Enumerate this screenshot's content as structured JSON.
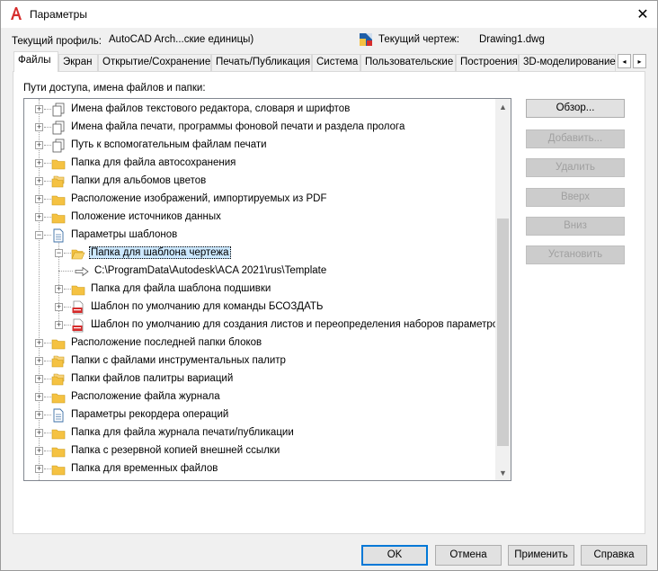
{
  "window": {
    "title": "Параметры",
    "close_symbol": "✕"
  },
  "profile": {
    "label": "Текущий профиль:",
    "value": "AutoCAD Arch...ские единицы)",
    "drawing_label": "Текущий чертеж:",
    "drawing_value": "Drawing1.dwg"
  },
  "tabs": [
    {
      "label": "Файлы",
      "active": true
    },
    {
      "label": "Экран"
    },
    {
      "label": "Открытие/Сохранение"
    },
    {
      "label": "Печать/Публикация"
    },
    {
      "label": "Система"
    },
    {
      "label": "Пользовательские"
    },
    {
      "label": "Построения"
    },
    {
      "label": "3D-моделирование"
    }
  ],
  "tab_scroll": {
    "left": "◂",
    "right": "▸"
  },
  "files": {
    "section_label": "Пути доступа, имена файлов и папки:",
    "tree": [
      {
        "label": "Имена файлов текстового редактора, словаря и шрифтов",
        "level": 0,
        "icon": "multi-doc-icon",
        "expander": "+"
      },
      {
        "label": "Имена файла печати, программы фоновой печати и раздела пролога",
        "level": 0,
        "icon": "multi-doc-icon",
        "expander": "+"
      },
      {
        "label": "Путь к вспомогательным файлам печати",
        "level": 0,
        "icon": "multi-doc-icon",
        "expander": "+"
      },
      {
        "label": "Папка для файла автосохранения",
        "level": 0,
        "icon": "folder-icon",
        "expander": "+"
      },
      {
        "label": "Папки для альбомов цветов",
        "level": 0,
        "icon": "folders-icon",
        "expander": "+"
      },
      {
        "label": "Расположение изображений, импортируемых из PDF",
        "level": 0,
        "icon": "folder-icon",
        "expander": "+"
      },
      {
        "label": "Положение источников данных",
        "level": 0,
        "icon": "folder-icon",
        "expander": "+"
      },
      {
        "label": "Параметры шаблонов",
        "level": 0,
        "icon": "document-icon",
        "expander": "−"
      },
      {
        "label": "Папка для шаблона чертежа",
        "level": 1,
        "icon": "open-folder-icon",
        "expander": "−",
        "selected": true
      },
      {
        "label": "C:\\ProgramData\\Autodesk\\ACA 2021\\rus\\Template",
        "level": 2,
        "icon": "arrow-icon",
        "expander": ""
      },
      {
        "label": "Папка для файла шаблона подшивки",
        "level": 1,
        "icon": "folder-icon",
        "expander": "+"
      },
      {
        "label": "Шаблон по умолчанию для команды БСОЗДАТЬ",
        "level": 1,
        "icon": "dwt-file-icon",
        "expander": "+"
      },
      {
        "label": "Шаблон по умолчанию для создания листов и переопределения наборов параметров",
        "level": 1,
        "icon": "dwt-file-icon",
        "expander": "+"
      },
      {
        "label": "Расположение последней папки блоков",
        "level": 0,
        "icon": "folder-icon",
        "expander": "+"
      },
      {
        "label": "Папки с файлами инструментальных палитр",
        "level": 0,
        "icon": "folders-icon",
        "expander": "+"
      },
      {
        "label": "Папки файлов палитры вариаций",
        "level": 0,
        "icon": "folders-icon",
        "expander": "+"
      },
      {
        "label": "Расположение файла журнала",
        "level": 0,
        "icon": "folder-icon",
        "expander": "+"
      },
      {
        "label": "Параметры рекордера операций",
        "level": 0,
        "icon": "document-icon",
        "expander": "+"
      },
      {
        "label": "Папка для файла журнала печати/публикации",
        "level": 0,
        "icon": "folder-icon",
        "expander": "+"
      },
      {
        "label": "Папка с резервной копией внешней ссылки",
        "level": 0,
        "icon": "folder-icon",
        "expander": "+"
      },
      {
        "label": "Папка для временных файлов",
        "level": 0,
        "icon": "folder-icon",
        "expander": "+"
      }
    ],
    "scroll_up": "▲",
    "scroll_down": "▼",
    "side_buttons": [
      {
        "label": "Обзор...",
        "enabled": true
      },
      {
        "label": "Добавить...",
        "enabled": false
      },
      {
        "label": "Удалить",
        "enabled": false
      },
      {
        "label": "Вверх",
        "enabled": false
      },
      {
        "label": "Вниз",
        "enabled": false
      },
      {
        "label": "Установить",
        "enabled": false
      }
    ]
  },
  "footer": {
    "ok": "OK",
    "cancel": "Отмена",
    "apply": "Применить",
    "help": "Справка"
  },
  "colors": {
    "selection": "#cce8ff",
    "folder": "#f5c242",
    "focus_border": "#0078d7",
    "app_icon": "#d62c2c"
  }
}
